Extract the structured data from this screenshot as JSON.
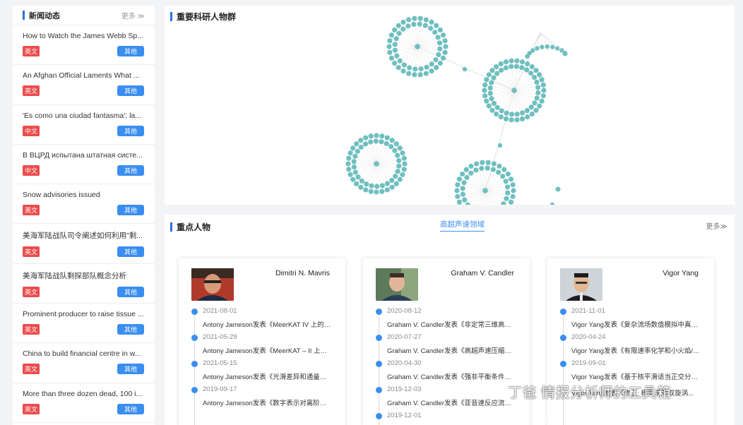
{
  "news": {
    "title": "新闻动态",
    "more": "更多 ≫",
    "items": [
      {
        "title": "How to Watch the James Webb Sp...",
        "lang": "英文",
        "category": "其他"
      },
      {
        "title": "An Afghan Official Laments What ...",
        "lang": "英文",
        "category": "其他"
      },
      {
        "title": "'Es como una ciudad fantasma': la...",
        "lang": "中文",
        "category": "其他"
      },
      {
        "title": "В ВЦРД испытана штатная систе...",
        "lang": "中文",
        "category": "其他"
      },
      {
        "title": "Snow advisories issued",
        "lang": "英文",
        "category": "其他"
      },
      {
        "title": "美海军陆战队司令阐述如何利用\"剩...",
        "lang": "英文",
        "category": "其他"
      },
      {
        "title": "美海军陆战队剩探部队概念分析",
        "lang": "英文",
        "category": "其他"
      },
      {
        "title": "Prominent producer to raise tissue ...",
        "lang": "英文",
        "category": "其他"
      },
      {
        "title": "China to build financial centre in w...",
        "lang": "英文",
        "category": "其他"
      },
      {
        "title": "More than three dozen dead, 100 i...",
        "lang": "英文",
        "category": "其他"
      }
    ]
  },
  "graph": {
    "title": "重要科研人物群",
    "accent": "#6fbfbf"
  },
  "people": {
    "title": "重点人物",
    "tab": "高超声速领域",
    "more": "更多≫",
    "cards": [
      {
        "name": "Dimitri N. Mavris",
        "entries": [
          {
            "date": "2021-08-01",
            "text": "Antony Jameson发表《MeerKAT IV 上的千..."
          },
          {
            "date": "2021-05-29",
            "text": "Antony Jameson发表《MeerKAT – II 上的千..."
          },
          {
            "date": "2021-05-15",
            "text": "Antony Jameson发表《光滑差异和通量重建..."
          },
          {
            "date": "2019-09-17",
            "text": "Antony Jameson发表《数字表示对离阶隐式..."
          }
        ]
      },
      {
        "name": "Graham V. Candler",
        "entries": [
          {
            "date": "2020-08-12",
            "text": "Graham V. Candler发表《非定常三维高超声..."
          },
          {
            "date": "2020-07-27",
            "text": "Graham V. Candler发表《高超声速压缩斜坡..."
          },
          {
            "date": "2020-04-30",
            "text": "Graham V. Candler发表《强非平衡条件下冲..."
          },
          {
            "date": "2019-12-03",
            "text": "Graham V. Candler发表《亚音速反应流动数..."
          },
          {
            "date": "2019-12-01",
            "text": ""
          }
        ]
      },
      {
        "name": "Vigor Yang",
        "entries": [
          {
            "date": "2021-11-01",
            "text": "Vigor Yang发表《复杂流场数值模拟中真实流..."
          },
          {
            "date": "2020-04-24",
            "text": "Vigor Yang发表《有限速率化学和小火焰/进..."
          },
          {
            "date": "2019-09-01",
            "text": "Vigor Yang发表《基于核平滑适当正交分解的..."
          },
          {
            "date": "",
            "text": "Vigor Yang发表《修正: 模型滑跳双旋涡..."
          }
        ]
      }
    ]
  },
  "watermark": "丁爸 情报分析师的工具箱"
}
